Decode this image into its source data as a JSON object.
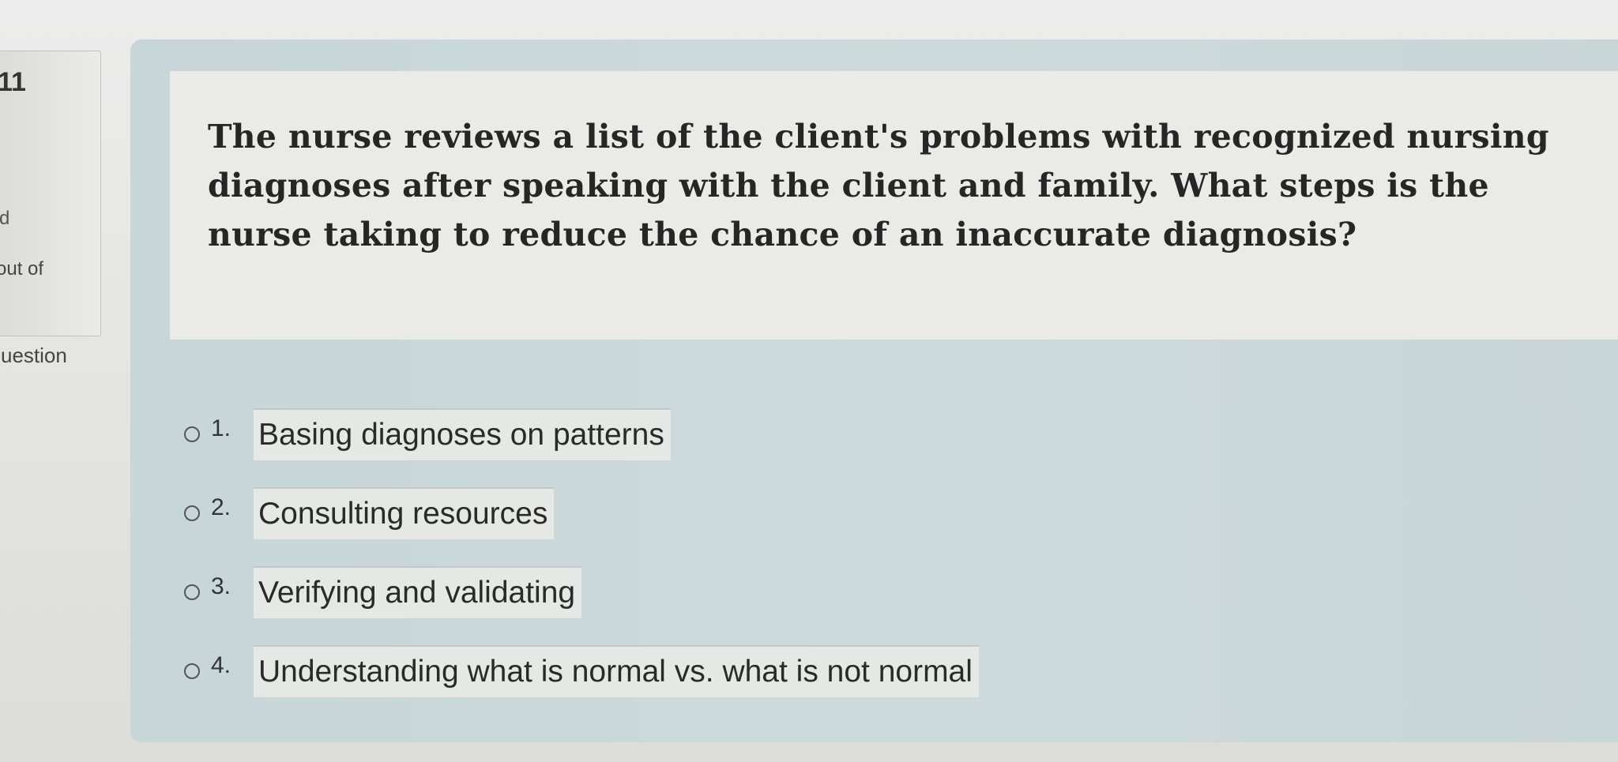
{
  "sidebar": {
    "question_number": "11",
    "status": "d",
    "points_label": "out of",
    "flag_label": "uestion"
  },
  "question": {
    "text": "The nurse reviews a list of the client's problems with recognized nursing diagnoses after speaking with the client and family. What steps is the nurse taking to reduce the chance of an inaccurate diagnosis?"
  },
  "options": [
    {
      "number": "1.",
      "label": "Basing diagnoses on patterns"
    },
    {
      "number": "2.",
      "label": "Consulting resources"
    },
    {
      "number": "3.",
      "label": "Verifying and validating"
    },
    {
      "number": "4.",
      "label": "Understanding what is normal vs. what is not normal"
    }
  ],
  "icons": {
    "option_radio": "radio-unselected-icon"
  },
  "colors": {
    "container_bg": "#c9d7da",
    "question_box_bg": "#eaeae6",
    "answer_bg": "#e6e8e6",
    "text": "#262626"
  }
}
